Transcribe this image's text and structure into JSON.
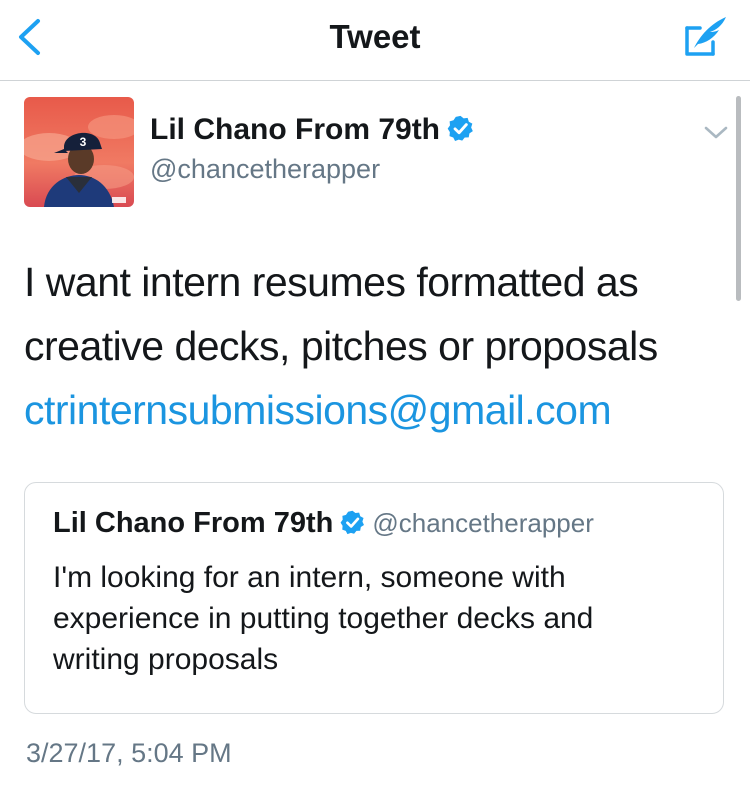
{
  "nav": {
    "title": "Tweet",
    "back_icon": "chevron-left-icon",
    "compose_icon": "compose-tweet-icon"
  },
  "tweet": {
    "author_name": "Lil Chano From 79th",
    "author_handle": "@chancetherapper",
    "verified": true,
    "text_lines": [
      "I want intern resumes formatted as",
      "creative decks, pitches or proposals"
    ],
    "link": "ctrinternsubmissions@gmail.com",
    "timestamp": "3/27/17, 5:04 PM"
  },
  "avatar": {
    "cap_number": "3"
  },
  "quoted_tweet": {
    "author_name": "Lil Chano From 79th",
    "author_handle": "@chancetherapper",
    "verified": true,
    "text_lines": [
      "I'm looking for an intern, someone with",
      "experience in putting together decks and",
      "writing proposals"
    ]
  },
  "colors": {
    "accent": "#1da1f2",
    "link": "#1b95e0",
    "text": "#14171a",
    "secondary_text": "#657786"
  }
}
